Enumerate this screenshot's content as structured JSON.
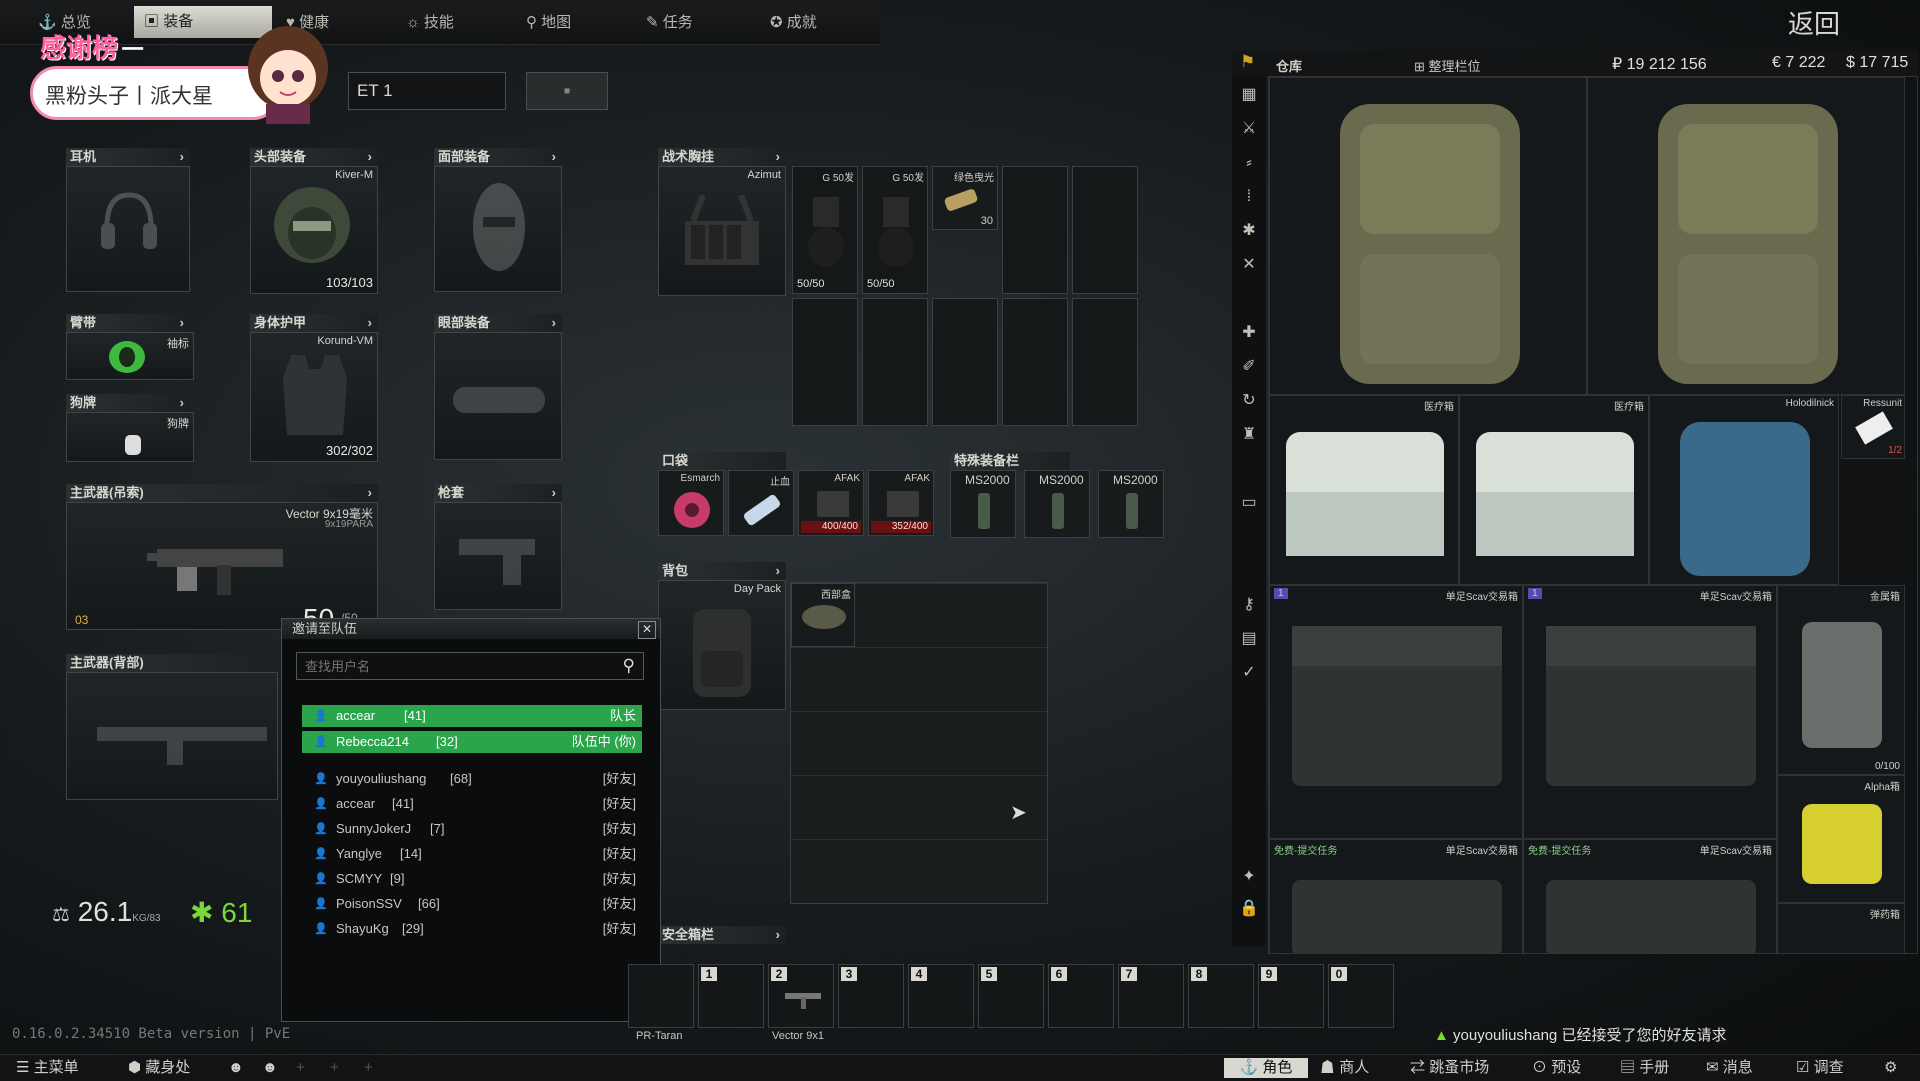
{
  "nav": {
    "tabs": [
      "总览",
      "装备",
      "健康",
      "技能",
      "地图",
      "任务",
      "成就"
    ],
    "back": "返回"
  },
  "overlay": {
    "thanks": "感谢榜",
    "banner_text": "黑粉头子丨派大星",
    "preset_tail": "ET 1"
  },
  "gear": {
    "earpiece": {
      "label": "耳机"
    },
    "headwear": {
      "label": "头部装备",
      "item": "Kiver-M",
      "durability": "103/103"
    },
    "facecover": {
      "label": "面部装备"
    },
    "armband": {
      "label": "臂带",
      "item": "袖标"
    },
    "body_armor": {
      "label": "身体护甲",
      "item": "Korund-VM",
      "durability": "302/302"
    },
    "eyewear": {
      "label": "眼部装备"
    },
    "dogtag": {
      "label": "狗牌",
      "item": "狗牌"
    },
    "primary_sling": {
      "label": "主武器(吊索)",
      "item": "Vector 9x19毫米",
      "sub": "9x19PARA",
      "ammo": "50",
      "ammo_max": "/50",
      "level": "03"
    },
    "holster": {
      "label": "枪套"
    },
    "primary_back": {
      "label": "主武器(背部)"
    },
    "tactical_rig": {
      "label": "战术胸挂",
      "item": "Azimut"
    },
    "rig_items": [
      {
        "name": "G 50发",
        "count": "50/50"
      },
      {
        "name": "G 50发",
        "count": "50/50"
      },
      {
        "name": "绿色曳光",
        "count": "30"
      }
    ],
    "pockets": {
      "label": "口袋",
      "items": [
        "Esmarch",
        "止血",
        "AFAK",
        "AFAK"
      ],
      "afak1": "400/400",
      "afak2": "352/400"
    },
    "special": {
      "label": "特殊装备栏",
      "items": [
        "MS2000",
        "MS2000",
        "MS2000"
      ]
    },
    "backpack": {
      "label": "背包",
      "item": "Day Pack",
      "inner": "西部盒"
    },
    "secure": {
      "label": "安全箱栏"
    }
  },
  "stats": {
    "weight": "26.1",
    "weight_unit": "KG",
    "weight_max": "/83",
    "hydration": "61"
  },
  "invite": {
    "title": "邀请至队伍",
    "search_placeholder": "查找用户名",
    "party": [
      {
        "name": "accear",
        "level": "[41]",
        "status": "队长"
      },
      {
        "name": "Rebecca214",
        "level": "[32]",
        "status": "队伍中 (你)"
      }
    ],
    "friends": [
      {
        "name": "youyouliushang",
        "level": "[68]",
        "status": "[好友]"
      },
      {
        "name": "accear",
        "level": "[41]",
        "status": "[好友]"
      },
      {
        "name": "SunnyJokerJ",
        "level": "[7]",
        "status": "[好友]"
      },
      {
        "name": "Yanglye",
        "level": "[14]",
        "status": "[好友]"
      },
      {
        "name": "SCMYY",
        "level": "[9]",
        "status": "[好友]"
      },
      {
        "name": "PoisonSSV",
        "level": "[66]",
        "status": "[好友]"
      },
      {
        "name": "ShayuKg",
        "level": "[29]",
        "status": "[好友]"
      }
    ]
  },
  "stash": {
    "title": "仓库",
    "sort": "整理栏位",
    "roubles": "₽ 19 212 156",
    "euros": "€ 7 222",
    "dollars": "$ 17 715",
    "labels": [
      "医疗箱",
      "医疗箱",
      "Holodilnick",
      "Ressunit",
      "单足Scav交易箱",
      "单足Scav交易箱",
      "金属箱",
      "Alpha箱",
      "免费-提交任务",
      "单足Scav交易箱",
      "免费-提交任务",
      "单足Scav交易箱",
      "弹药箱"
    ],
    "ressunit_count": "1/2",
    "jerry": "0/100",
    "tags": [
      "1",
      "1"
    ]
  },
  "quickbar": {
    "slots": [
      "1",
      "2",
      "3",
      "4",
      "5",
      "6",
      "7",
      "8",
      "9",
      "0"
    ],
    "under": [
      "PR-Taran",
      "Vector 9x1"
    ]
  },
  "version": "0.16.0.2.34510 Beta version | PvE",
  "notice": "youyouliushang 已经接受了您的好友请求",
  "bottom": {
    "left": [
      "主菜单",
      "藏身处"
    ],
    "right": [
      "角色",
      "商人",
      "跳蚤市场",
      "预设",
      "手册",
      "消息",
      "调查"
    ]
  }
}
